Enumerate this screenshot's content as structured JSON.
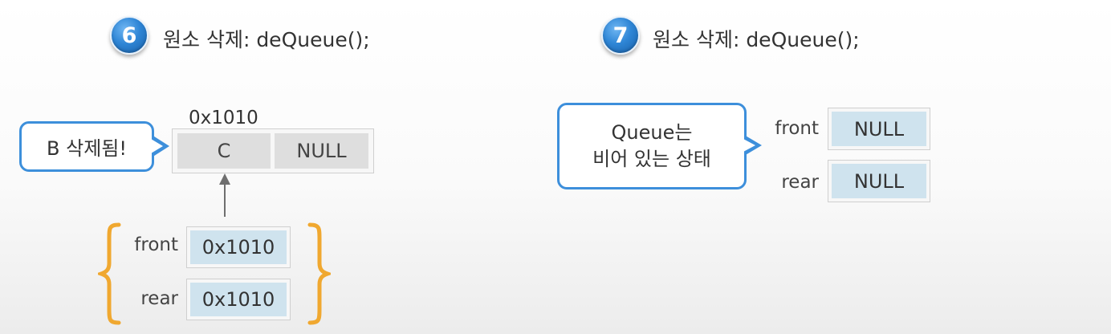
{
  "panels": [
    {
      "step_number": "6",
      "title": "원소 삭제: deQueue();",
      "callout": "B 삭제됨!",
      "node": {
        "address": "0x1010",
        "data": "C",
        "link": "NULL"
      },
      "pointers": [
        {
          "label": "front",
          "value": "0x1010"
        },
        {
          "label": "rear",
          "value": "0x1010"
        }
      ]
    },
    {
      "step_number": "7",
      "title": "원소 삭제: deQueue();",
      "callout_lines": [
        "Queue는",
        "비어 있는 상태"
      ],
      "pointers": [
        {
          "label": "front",
          "value": "NULL"
        },
        {
          "label": "rear",
          "value": "NULL"
        }
      ]
    }
  ],
  "colors": {
    "step_badge": "#2f86d6",
    "callout_border": "#3d8fdb",
    "pointer_cell": "#cfe3ee",
    "node_cell": "#dedede",
    "brace": "#f0a830"
  }
}
